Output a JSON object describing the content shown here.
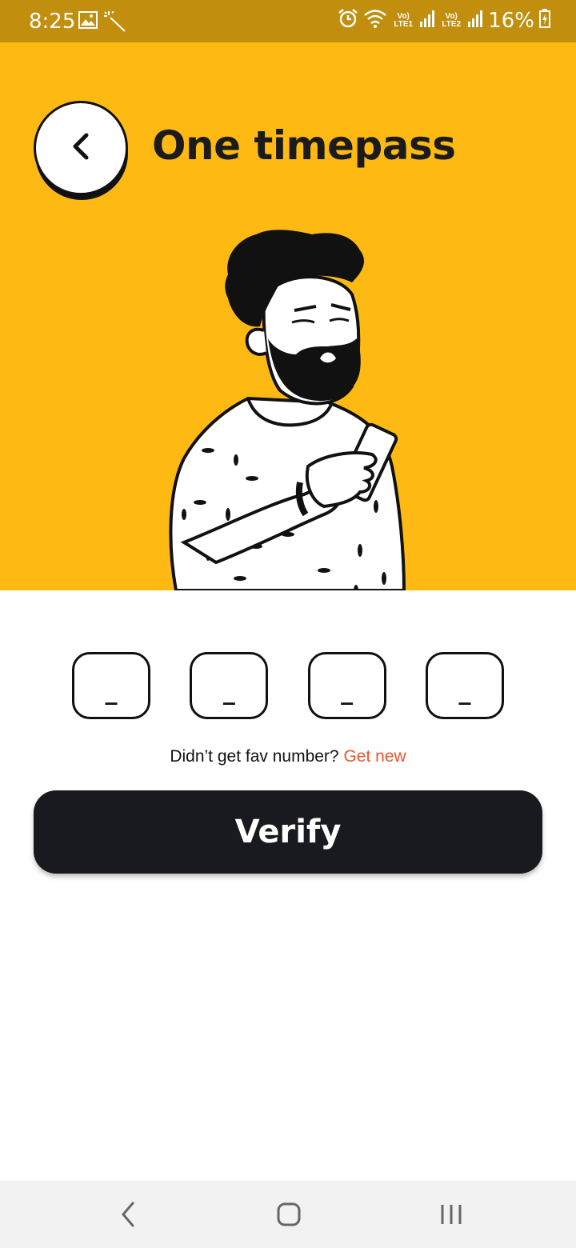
{
  "status_bar": {
    "time": "8:25",
    "battery_percent": "16%",
    "sim1_label": "Vo) LTE1",
    "sim2_label": "Vo) LTE2",
    "icons": [
      "image-icon",
      "magic-wand-icon",
      "alarm-icon",
      "wifi-icon",
      "signal-icon",
      "battery-charging-icon"
    ]
  },
  "header": {
    "title": "One timepass",
    "back_icon": "chevron-left-icon"
  },
  "otp": {
    "digits": [
      "_",
      "_",
      "_",
      "_"
    ]
  },
  "resend": {
    "prompt": "Didn’t get fav number?",
    "link": "Get new"
  },
  "verify_button": {
    "label": "Verify"
  },
  "nav_bar": {
    "icons": [
      "back-icon",
      "home-icon",
      "recents-icon"
    ]
  },
  "colors": {
    "status_bar": "#C18E0E",
    "hero_background": "#FEBA12",
    "button": "#191A1F",
    "link": "#E5572C"
  }
}
